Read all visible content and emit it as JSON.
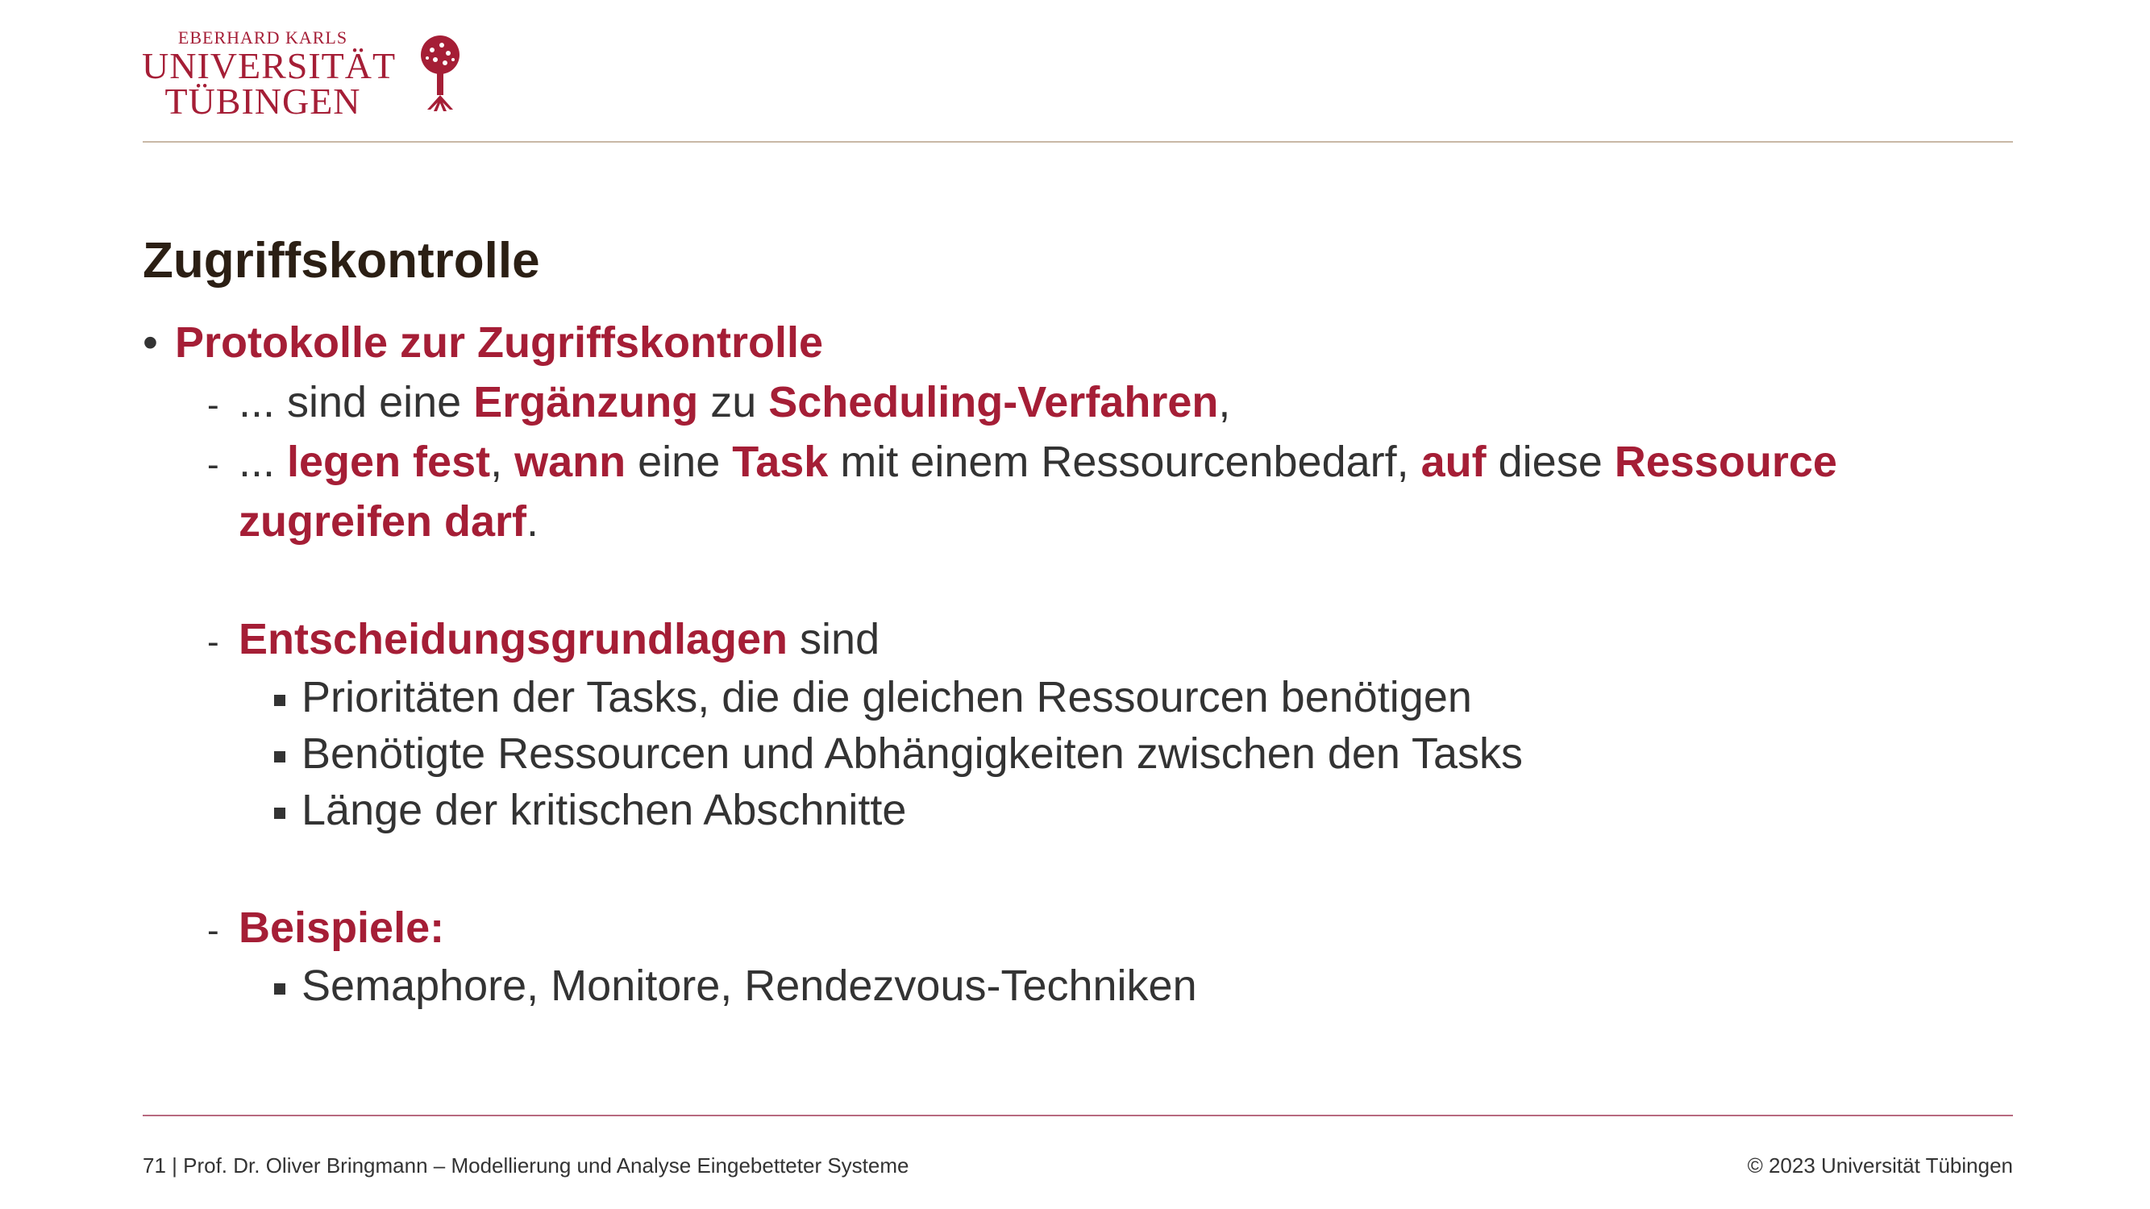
{
  "logo": {
    "line1": "EBERHARD KARLS",
    "line2": "UNIVERSITÄT",
    "line3": "TÜBINGEN",
    "icon": "tree-seal-icon",
    "color": "#a51e36"
  },
  "title": "Zugriffskontrolle",
  "bullet1": "Protokolle zur Zugriffskontrolle",
  "sub1": {
    "a": "...  sind eine ",
    "b": "Ergänzung",
    "c": " zu ",
    "d": "Scheduling-Verfahren",
    "e": ","
  },
  "sub2": {
    "a": "...  ",
    "b": "legen fest",
    "c": ", ",
    "d": "wann",
    "e": " eine ",
    "f": "Task",
    "g": " mit einem Ressourcenbedarf, ",
    "h": "auf",
    "i": " diese ",
    "j": "Ressource",
    "k": "zugreifen darf",
    "l": "."
  },
  "sub3": {
    "a": "Entscheidungsgrundlagen",
    "b": " sind"
  },
  "sub3_items": [
    "Prioritäten der Tasks, die die gleichen Ressourcen benötigen",
    "Benötigte Ressourcen und Abhängigkeiten zwischen den Tasks",
    "Länge der kritischen Abschnitte"
  ],
  "sub4": "Beispiele:",
  "sub4_items": [
    "Semaphore, Monitore, Rendezvous-Techniken"
  ],
  "footer": {
    "left": "71 | Prof. Dr. Oliver Bringmann – Modellierung und Analyse Eingebetteter Systeme",
    "right": "© 2023 Universität Tübingen"
  },
  "colors": {
    "accent": "#a51e36",
    "text": "#333333",
    "title": "#2b1f14"
  }
}
